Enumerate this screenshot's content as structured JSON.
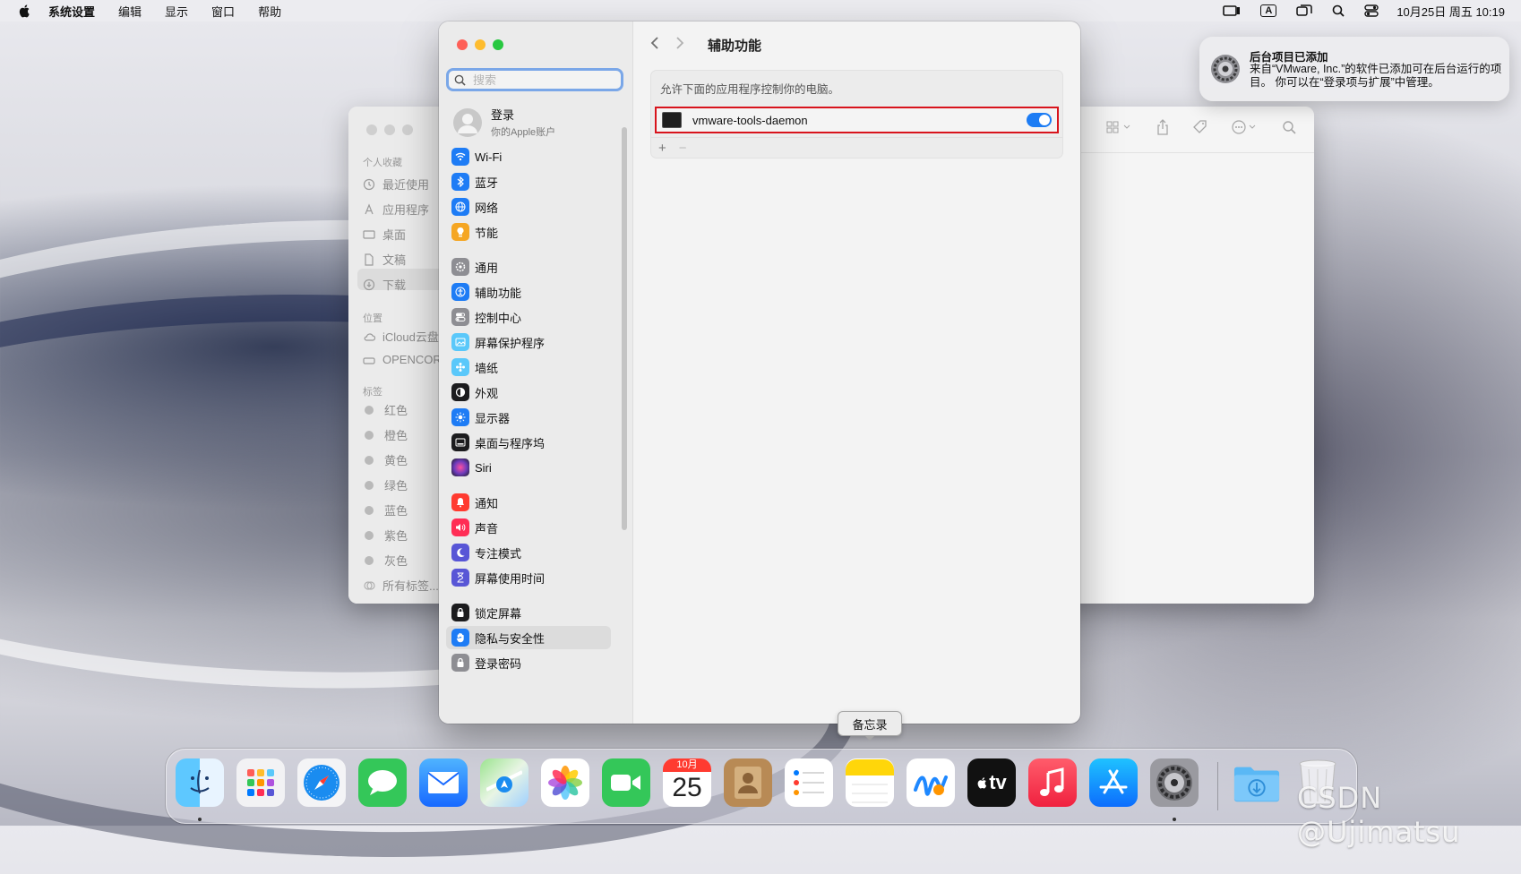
{
  "menubar": {
    "app_name": "系统设置",
    "items": [
      "编辑",
      "显示",
      "窗口",
      "帮助"
    ],
    "input_indicator": "A",
    "clock": "10月25日 周五  10:19"
  },
  "finder": {
    "favorites_header": "个人收藏",
    "favorites": [
      "最近使用",
      "应用程序",
      "桌面",
      "文稿",
      "下载"
    ],
    "locations_header": "位置",
    "locations": [
      "iCloud云盘",
      "OPENCORE"
    ],
    "tags_header": "标签",
    "tags": [
      {
        "label": "红色"
      },
      {
        "label": "橙色"
      },
      {
        "label": "黄色"
      },
      {
        "label": "绿色"
      },
      {
        "label": "蓝色"
      },
      {
        "label": "紫色"
      },
      {
        "label": "灰色"
      },
      {
        "label": "所有标签..."
      }
    ]
  },
  "settings": {
    "search": {
      "placeholder": "搜索",
      "value": ""
    },
    "account": {
      "title": "登录",
      "subtitle": "你的Apple账户"
    },
    "sidebar": [
      {
        "label": "Wi-Fi",
        "color": "#1e7cf5",
        "icon": "wifi-icon"
      },
      {
        "label": "蓝牙",
        "color": "#1e7cf5",
        "icon": "bluetooth-icon"
      },
      {
        "label": "网络",
        "color": "#1e7cf5",
        "icon": "globe-icon"
      },
      {
        "label": "节能",
        "color": "#f5a623",
        "icon": "lightbulb-icon"
      },
      {
        "label": "通用",
        "color": "#8e8e93",
        "icon": "gear-icon"
      },
      {
        "label": "辅助功能",
        "color": "#1e7cf5",
        "icon": "accessibility-icon"
      },
      {
        "label": "控制中心",
        "color": "#8e8e93",
        "icon": "switches-icon"
      },
      {
        "label": "屏幕保护程序",
        "color": "#5ac8fa",
        "icon": "screensaver-icon"
      },
      {
        "label": "墙纸",
        "color": "#5ac8fa",
        "icon": "flower-icon"
      },
      {
        "label": "外观",
        "color": "#1c1c1e",
        "icon": "appearance-icon"
      },
      {
        "label": "显示器",
        "color": "#1e7cf5",
        "icon": "sun-icon"
      },
      {
        "label": "桌面与程序坞",
        "color": "#1c1c1e",
        "icon": "dock-icon"
      },
      {
        "label": "Siri",
        "color": "#6e3cbc",
        "icon": "siri-icon"
      },
      {
        "label": "通知",
        "color": "#ff3b30",
        "icon": "bell-icon"
      },
      {
        "label": "声音",
        "color": "#ff2d55",
        "icon": "speaker-icon"
      },
      {
        "label": "专注模式",
        "color": "#5856d6",
        "icon": "moon-icon"
      },
      {
        "label": "屏幕使用时间",
        "color": "#5856d6",
        "icon": "hourglass-icon"
      },
      {
        "label": "锁定屏幕",
        "color": "#1c1c1e",
        "icon": "lock-icon"
      },
      {
        "label": "隐私与安全性",
        "color": "#1e7cf5",
        "icon": "hand-icon"
      },
      {
        "label": "登录密码",
        "color": "#8e8e93",
        "icon": "lock-icon"
      }
    ],
    "selected_item": "隐私与安全性",
    "page_title": "辅助功能",
    "description": "允许下面的应用程序控制你的电脑。",
    "apps": [
      {
        "name": "vmware-tools-daemon",
        "enabled": true
      }
    ],
    "add_label": "+",
    "remove_label": "−"
  },
  "notification": {
    "title": "后台项目已添加",
    "body": "来自“VMware, Inc.”的软件已添加可在后台运行的项目。 你可以在“登录项与扩展”中管理。"
  },
  "tooltip": "备忘录",
  "dock": {
    "calendar_month": "10月",
    "calendar_day": "25",
    "tv_label": "tv",
    "apps": [
      "Finder",
      "Launchpad",
      "Safari",
      "信息",
      "邮件",
      "地图",
      "照片",
      "FaceTime通话",
      "日历",
      "通讯录",
      "提醒事项",
      "备忘录",
      "无边记",
      "TV",
      "音乐",
      "App Store",
      "系统设置",
      "下载",
      "废纸篓"
    ]
  },
  "watermark": "CSDN @Ujimatsu"
}
